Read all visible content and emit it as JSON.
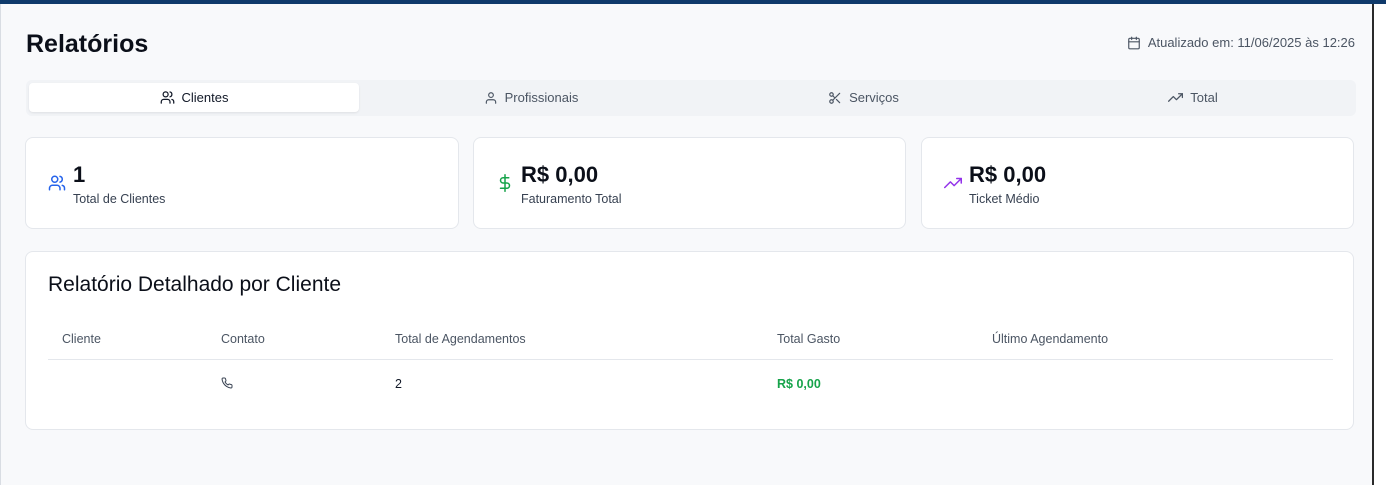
{
  "header": {
    "title": "Relatórios",
    "updated_text": "Atualizado em: 11/06/2025 às 12:26"
  },
  "tabs": [
    {
      "label": "Clientes",
      "icon": "users-icon",
      "active": true
    },
    {
      "label": "Profissionais",
      "icon": "user-icon",
      "active": false
    },
    {
      "label": "Serviços",
      "icon": "scissors-icon",
      "active": false
    },
    {
      "label": "Total",
      "icon": "trending-up-icon",
      "active": false
    }
  ],
  "stats": [
    {
      "value": "1",
      "label": "Total de Clientes",
      "icon": "users-icon",
      "color": "#2563eb"
    },
    {
      "value": "R$ 0,00",
      "label": "Faturamento Total",
      "icon": "dollar-icon",
      "color": "#16a34a"
    },
    {
      "value": "R$ 0,00",
      "label": "Ticket Médio",
      "icon": "trending-up-icon",
      "color": "#9333ea"
    }
  ],
  "report": {
    "title": "Relatório Detalhado por Cliente",
    "columns": [
      "Cliente",
      "Contato",
      "Total de Agendamentos",
      "Total Gasto",
      "Último Agendamento"
    ],
    "rows": [
      {
        "cliente": "",
        "contato_icon": "phone-icon",
        "total_agendamentos": "2",
        "total_gasto": "R$ 0,00",
        "ultimo_agendamento": ""
      }
    ]
  },
  "colors": {
    "accent_bar": "#0f3a6b",
    "money_green": "#16a34a"
  }
}
